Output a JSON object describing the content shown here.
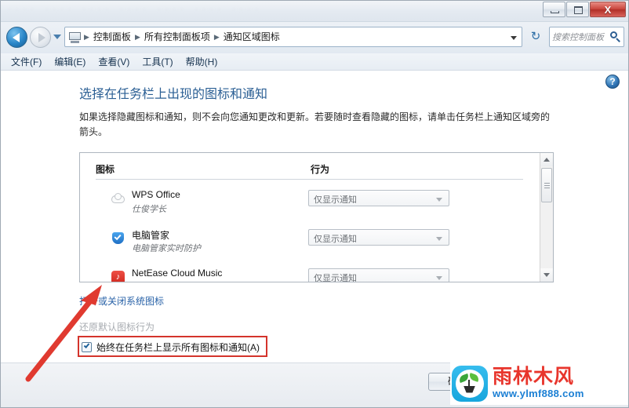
{
  "window": {
    "minimize_label": "–",
    "maximize_label": "□",
    "close_label": "X",
    "titlebar_ghost_text": "····  ····  ····  ····  ····  ····  ····"
  },
  "nav": {
    "back_icon": "back-arrow-icon",
    "forward_icon": "forward-arrow-icon",
    "recent_icon": "recent-pages-chevron-icon",
    "computer_icon": "computer-icon",
    "breadcrumbs": [
      "控制面板",
      "所有控制面板项",
      "通知区域图标"
    ],
    "separator": "▶",
    "address_chevron_icon": "chevron-down-icon",
    "refresh_icon": "↻",
    "search_placeholder": "搜索控制面板",
    "search_icon": "search-icon"
  },
  "menubar": {
    "items": [
      "文件(F)",
      "编辑(E)",
      "查看(V)",
      "工具(T)",
      "帮助(H)"
    ]
  },
  "content": {
    "help_icon_label": "?",
    "title": "选择在任务栏上出现的图标和通知",
    "description": "如果选择隐藏图标和通知，则不会向您通知更改和更新。若要随时查看隐藏的图标，请单击任务栏上通知区域旁的箭头。"
  },
  "list": {
    "headers": {
      "icon": "图标",
      "behavior": "行为"
    },
    "rows": [
      {
        "icon": "wps-office-cloud-icon",
        "name": "WPS Office",
        "subtitle": "仕俊学长",
        "behavior": "仅显示通知"
      },
      {
        "icon": "pc-manager-shield-icon",
        "name": "电脑管家",
        "subtitle": "电脑管家实时防护",
        "behavior": "仅显示通知"
      },
      {
        "icon": "netease-cloud-music-icon",
        "name": "NetEase Cloud Music",
        "subtitle": "",
        "behavior": "仅显示通知"
      }
    ],
    "scrollbar": {
      "up_icon": "scroll-up-arrow-icon",
      "down_icon": "scroll-down-arrow-icon"
    }
  },
  "options": {
    "system_icons_link": "打开或关闭系统图标",
    "restore_defaults_link": "还原默认图标行为",
    "always_show_checkbox_label": "始终在任务栏上显示所有图标和通知(A)",
    "always_show_checked": true
  },
  "footer": {
    "ok_label": "确定"
  },
  "annotation": {
    "highlight_color": "#d4342c",
    "arrow_color": "#e03a30"
  },
  "watermark": {
    "brand": "雨林木风",
    "url": "www.ylmf888.com",
    "logo_icon": "plant-logo-icon"
  }
}
